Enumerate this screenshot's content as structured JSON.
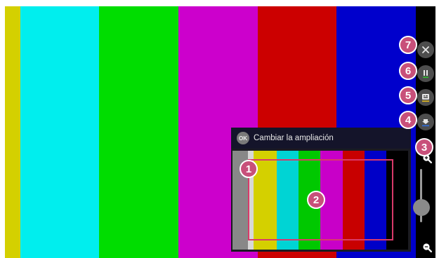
{
  "screen": {
    "bars": [
      "#d4d000",
      "#00eeee",
      "#00dd00",
      "#cc00cc",
      "#cc0000",
      "#0000cc",
      "#000000"
    ],
    "thumb_bars": [
      "#888888",
      "#d8d8d8",
      "#d4d000",
      "#00d4d4",
      "#00c800",
      "#c800c8",
      "#c80000",
      "#0000c8",
      "#000000"
    ]
  },
  "magnifier": {
    "ok_label": "OK",
    "title": "Cambiar la ampliación"
  },
  "controls": {
    "close": "close-icon",
    "pause": "pause-icon",
    "caption": "caption-icon",
    "move": "move-down-icon",
    "zoom_in": "zoom-in-icon",
    "zoom_out": "zoom-out-icon"
  },
  "zoom_level_fraction": 0.28,
  "badges": {
    "b1": "1",
    "b2": "2",
    "b3": "3",
    "b4": "4",
    "b5": "5",
    "b6": "6",
    "b7": "7"
  },
  "colors": {
    "badge": "#c8507a",
    "zoom_rect": "#d93a6a"
  }
}
